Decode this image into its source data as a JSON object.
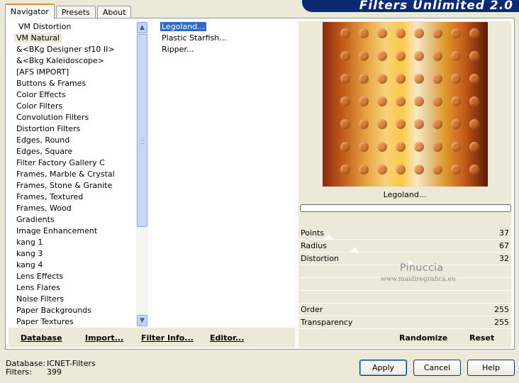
{
  "window": {
    "title": "Filters Unlimited 2.0"
  },
  "tabs": [
    {
      "label": "Navigator",
      "active": true
    },
    {
      "label": "Presets",
      "active": false
    },
    {
      "label": "About",
      "active": false
    }
  ],
  "categories": [
    "VM Distortion",
    "VM Natural",
    "&<BKg Designer sf10 II>",
    "&<Bkg Kaleidoscope>",
    "[AFS IMPORT]",
    "Buttons & Frames",
    "Color Effects",
    "Color Filters",
    "Convolution Filters",
    "Distortion Filters",
    "Edges, Round",
    "Edges, Square",
    "Filter Factory Gallery C",
    "Frames, Marble & Crystal",
    "Frames, Stone & Granite",
    "Frames, Textured",
    "Frames, Wood",
    "Gradients",
    "Image Enhancement",
    "kang 1",
    "kang 3",
    "kang 4",
    "Lens Effects",
    "Lens Flares",
    "Noise Filters",
    "Paper Backgrounds",
    "Paper Textures"
  ],
  "selected_category": "VM Natural",
  "filters": [
    "Legoland...",
    "Plastic Starfish...",
    "Ripper..."
  ],
  "selected_filter": "Legoland...",
  "left_buttons": {
    "database": "Database",
    "import": "Import...",
    "filter_info": "Filter Info...",
    "editor": "Editor..."
  },
  "preview": {
    "filter_name": "Legoland..."
  },
  "params": [
    {
      "label": "Points",
      "value": "37"
    },
    {
      "label": "Radius",
      "value": "67"
    },
    {
      "label": "Distortion",
      "value": "32"
    },
    {
      "label": "",
      "value": ""
    },
    {
      "label": "",
      "value": ""
    },
    {
      "label": "",
      "value": ""
    },
    {
      "label": "Order",
      "value": "255"
    },
    {
      "label": "Transparency",
      "value": "255"
    }
  ],
  "watermark": {
    "line1": "Pinuccia",
    "line2": "www.maidiregrafica.eu"
  },
  "right_buttons": {
    "randomize": "Randomize",
    "reset": "Reset"
  },
  "status": {
    "database_label": "Database:",
    "database_value": "ICNET-Filters",
    "filters_label": "Filters:",
    "filters_value": "399"
  },
  "dialog_buttons": {
    "apply": "Apply",
    "cancel": "Cancel",
    "help": "Help"
  },
  "colors": {
    "selection": "#316ac5",
    "banner": "#0a2a73",
    "tab_accent": "#e68b2c",
    "dot": "#d9752a"
  }
}
